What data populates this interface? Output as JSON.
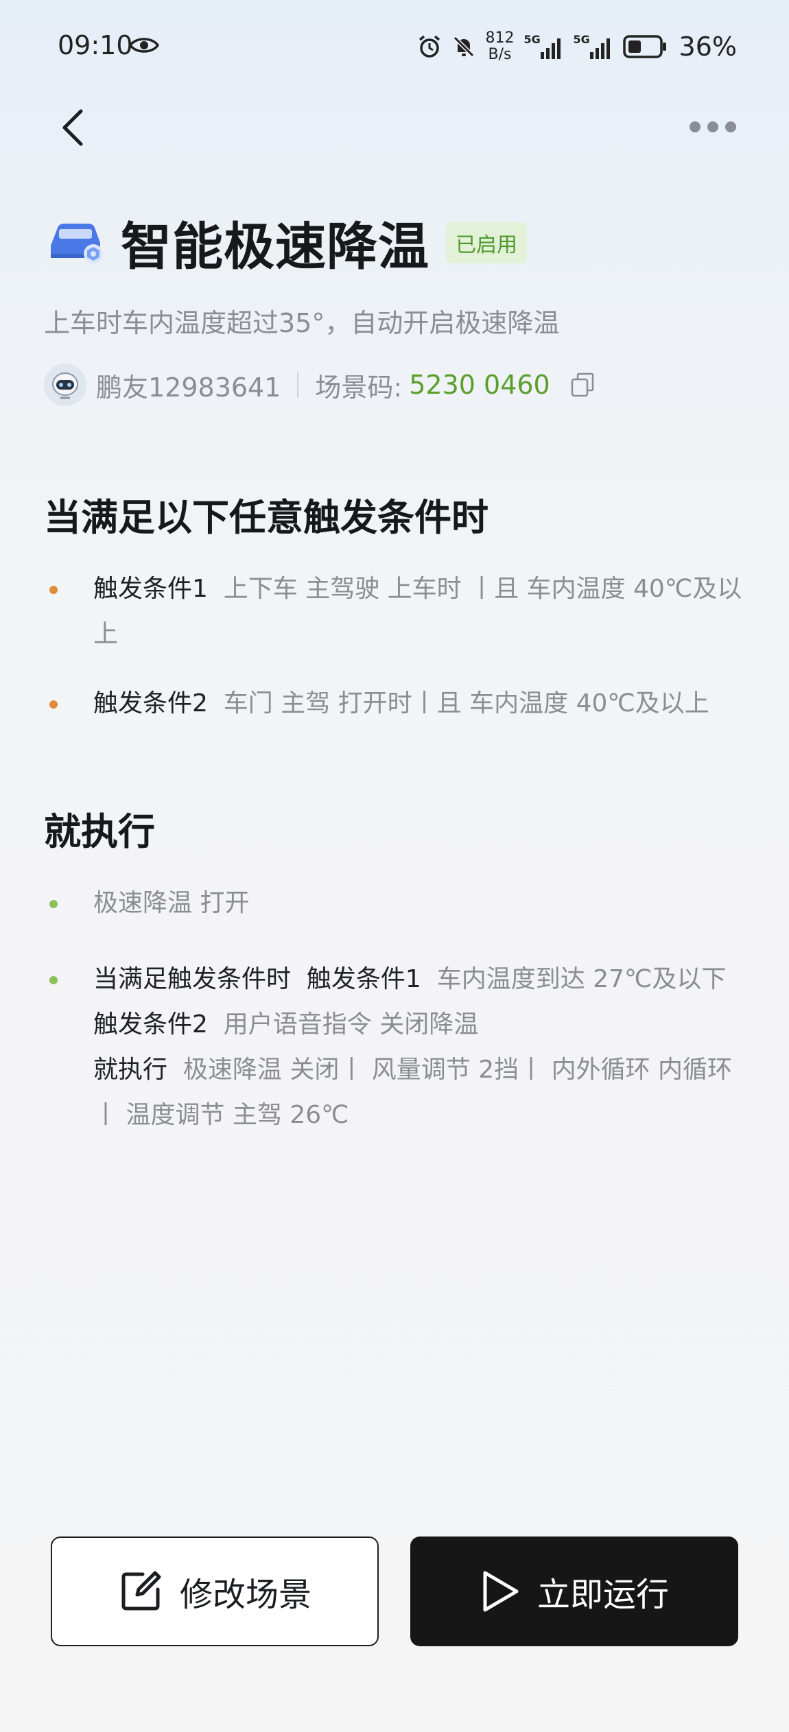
{
  "status_bar": {
    "time": "09:10",
    "speed_value": "812",
    "speed_unit": "B/s",
    "battery_pct": "36%",
    "network_1": "5G",
    "network_2": "5G"
  },
  "header": {
    "title": "智能极速降温",
    "badge": "已启用",
    "description": "上车时车内温度超过35°，自动开启极速降温",
    "author": "鹏友12983641",
    "scene_code_label": "场景码:",
    "scene_code_value": "5230 0460"
  },
  "triggers": {
    "title": "当满足以下任意触发条件时",
    "items": [
      {
        "label": "触发条件1",
        "detail": "上下车 主驾驶 上车时 丨且 车内温度 40℃及以上"
      },
      {
        "label": "触发条件2",
        "detail": "车门 主驾 打开时丨且 车内温度 40℃及以上"
      }
    ]
  },
  "actions": {
    "title": "就执行",
    "item1": "极速降温 打开",
    "item2": {
      "when_label": "当满足触发条件时",
      "cond1_label": "触发条件1",
      "cond1_detail": "车内温度到达 27℃及以下",
      "cond2_label": "触发条件2",
      "cond2_detail": "用户语音指令 关闭降温",
      "exec_label": "就执行",
      "exec_detail": "极速降温 关闭丨 风量调节 2挡丨 内外循环 内循环丨 温度调节 主驾 26℃"
    }
  },
  "buttons": {
    "edit": "修改场景",
    "run": "立即运行"
  },
  "colors": {
    "badge_text": "#4f9a2a",
    "scene_code": "#5b9f2b",
    "trigger_dot": "#e08a3c",
    "action_dot": "#8bbf5a",
    "run_button": "#161616"
  }
}
